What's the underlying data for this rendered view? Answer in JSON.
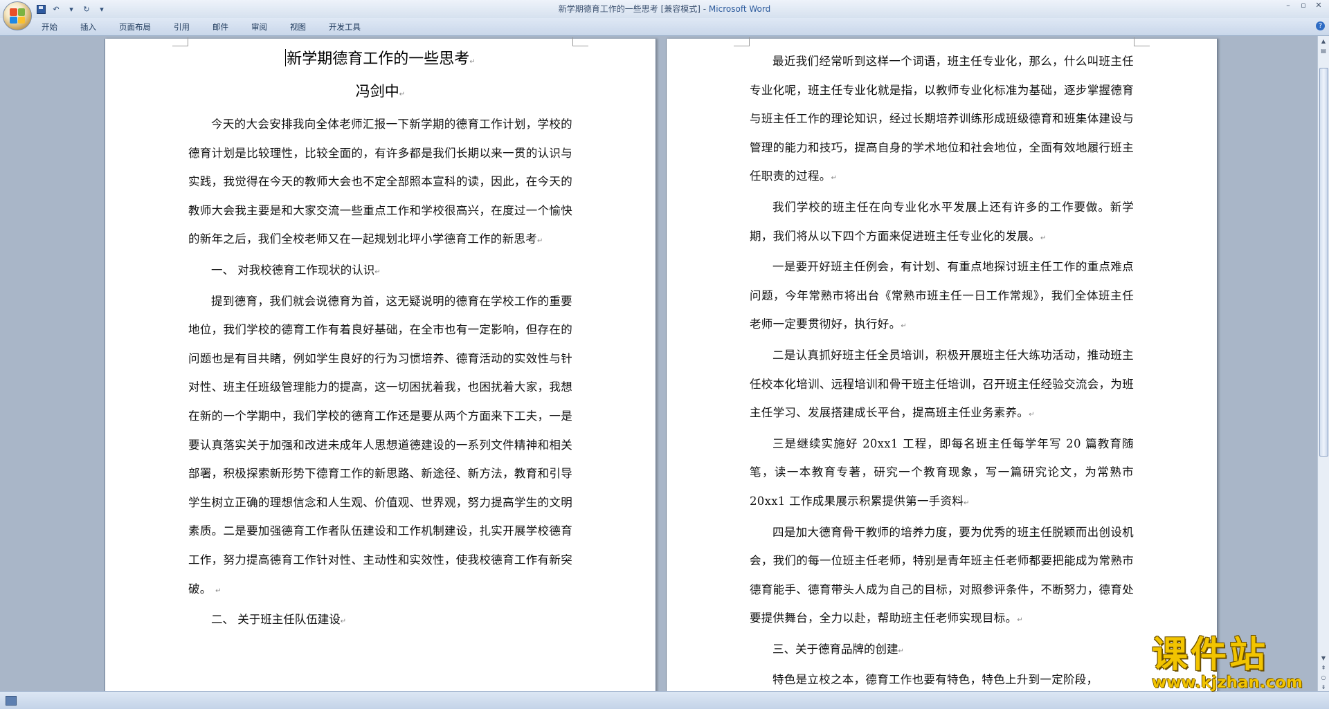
{
  "window": {
    "title_doc": "新学期德育工作的一些思考 [兼容模式] - ",
    "title_app": "Microsoft Word"
  },
  "ribbon": {
    "tabs": [
      "开始",
      "插入",
      "页面布局",
      "引用",
      "邮件",
      "审阅",
      "视图",
      "开发工具"
    ]
  },
  "page1": {
    "title": "新学期德育工作的一些思考",
    "author": "冯剑中",
    "p1": "今天的大会安排我向全体老师汇报一下新学期的德育工作计划，学校的德育计划是比较理性，比较全面的，有许多都是我们长期以来一贯的认识与实践，我觉得在今天的教师大会也不定全部照本宣科的读，因此，在今天的教师大会我主要是和大家交流一些重点工作和学校很高兴，在度过一个愉快的新年之后，我们全校老师又在一起规划北坪小学德育工作的新思考",
    "h1": "一、 对我校德育工作现状的认识",
    "p2": "提到德育，我们就会说德育为首，这无疑说明的德育在学校工作的重要地位，我们学校的德育工作有着良好基础，在全市也有一定影响，但存在的问题也是有目共睹，例如学生良好的行为习惯培养、德育活动的实效性与针对性、班主任班级管理能力的提高，这一切困扰着我，也困扰着大家，我想在新的一个学期中，我们学校的德育工作还是要从两个方面来下工夫，一是要认真落实关于加强和改进未成年人思想道德建设的一系列文件精神和相关部署，积极探索新形势下德育工作的新思路、新途径、新方法，教育和引导学生树立正确的理想信念和人生观、价值观、世界观，努力提高学生的文明素质。二是要加强德育工作者队伍建设和工作机制建设，扎实开展学校德育工作，努力提高德育工作针对性、主动性和实效性，使我校德育工作有新突破。",
    "h2": "二、 关于班主任队伍建设"
  },
  "page2": {
    "p1": "最近我们经常听到这样一个词语，班主任专业化，那么，什么叫班主任专业化呢，班主任专业化就是指，以教师专业化标准为基础，逐步掌握德育与班主任工作的理论知识，经过长期培养训练形成班级德育和班集体建设与管理的能力和技巧，提高自身的学术地位和社会地位，全面有效地履行班主任职责的过程。",
    "p2": "我们学校的班主任在向专业化水平发展上还有许多的工作要做。新学期，我们将从以下四个方面来促进班主任专业化的发展。",
    "p3": "一是要开好班主任例会，有计划、有重点地探讨班主任工作的重点难点问题，今年常熟市将出台《常熟市班主任一日工作常规》，我们全体班主任老师一定要贯彻好，执行好。",
    "p4": "二是认真抓好班主任全员培训，积极开展班主任大练功活动，推动班主任校本化培训、远程培训和骨干班主任培训，召开班主任经验交流会，为班主任学习、发展搭建成长平台，提高班主任业务素养。",
    "p5": "三是继续实施好 20xx1 工程，即每名班主任每学年写 20 篇教育随笔，读一本教育专著，研究一个教育现象，写一篇研究论文，为常熟市 20xx1 工作成果展示积累提供第一手资料",
    "p6": "四是加大德育骨干教师的培养力度，要为优秀的班主任脱颖而出创设机会，我们的每一位班主任老师，特别是青年班主任老师都要把能成为常熟市德育能手、德育带头人成为自己的目标，对照参评条件，不断努力，德育处要提供舞台，全力以赴，帮助班主任老师实现目标。",
    "h3": "三、关于德育品牌的创建",
    "p7": "特色是立校之本，德育工作也要有特色，特色上升到一定阶段，"
  },
  "watermark": {
    "main": "课件站",
    "sub": "www.kjzhan.com"
  },
  "colors": {
    "background": "#a9b6c8",
    "watermark": "#f2c400"
  }
}
